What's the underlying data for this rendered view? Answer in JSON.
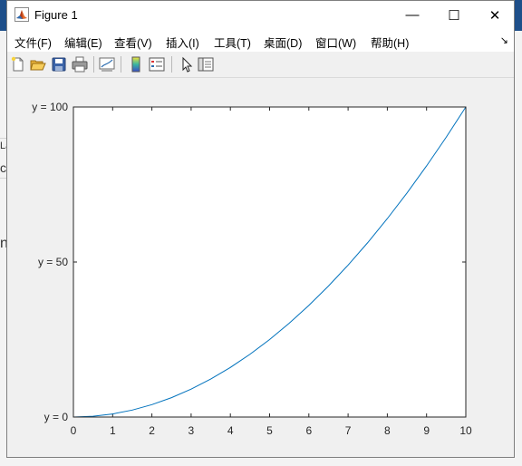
{
  "background": {
    "fragments": [
      "La",
      "ck",
      "n"
    ]
  },
  "window": {
    "title": "Figure 1",
    "controls": {
      "minimize": "—",
      "maximize": "☐",
      "close": "✕"
    }
  },
  "menubar": {
    "items": [
      "文件(F)",
      "编辑(E)",
      "查看(V)",
      "插入(I)",
      "工具(T)",
      "桌面(D)",
      "窗口(W)",
      "帮助(H)"
    ],
    "overflow_glyph": "↘"
  },
  "toolbar": {
    "buttons": [
      "new-figure-icon",
      "open-file-icon",
      "save-icon",
      "print-icon",
      "link-plot-icon",
      "colorbar-icon",
      "legend-icon",
      "pointer-icon",
      "property-editor-icon"
    ]
  },
  "chart_data": {
    "type": "line",
    "function": "y = x^2",
    "x": [
      0,
      0.5,
      1,
      1.5,
      2,
      2.5,
      3,
      3.5,
      4,
      4.5,
      5,
      5.5,
      6,
      6.5,
      7,
      7.5,
      8,
      8.5,
      9,
      9.5,
      10
    ],
    "y": [
      0,
      0.25,
      1,
      2.25,
      4,
      6.25,
      9,
      12.25,
      16,
      20.25,
      25,
      30.25,
      36,
      42.25,
      49,
      56.25,
      64,
      72.25,
      81,
      90.25,
      100
    ],
    "xlim": [
      0,
      10
    ],
    "ylim": [
      0,
      100
    ],
    "xticks": [
      "0",
      "1",
      "2",
      "3",
      "4",
      "5",
      "6",
      "7",
      "8",
      "9",
      "10"
    ],
    "xtick_values": [
      0,
      1,
      2,
      3,
      4,
      5,
      6,
      7,
      8,
      9,
      10
    ],
    "yticks": [
      "y = 0",
      "y = 50",
      "y = 100"
    ],
    "ytick_values": [
      0,
      50,
      100
    ],
    "line_color": "#0072bd",
    "grid": false
  }
}
